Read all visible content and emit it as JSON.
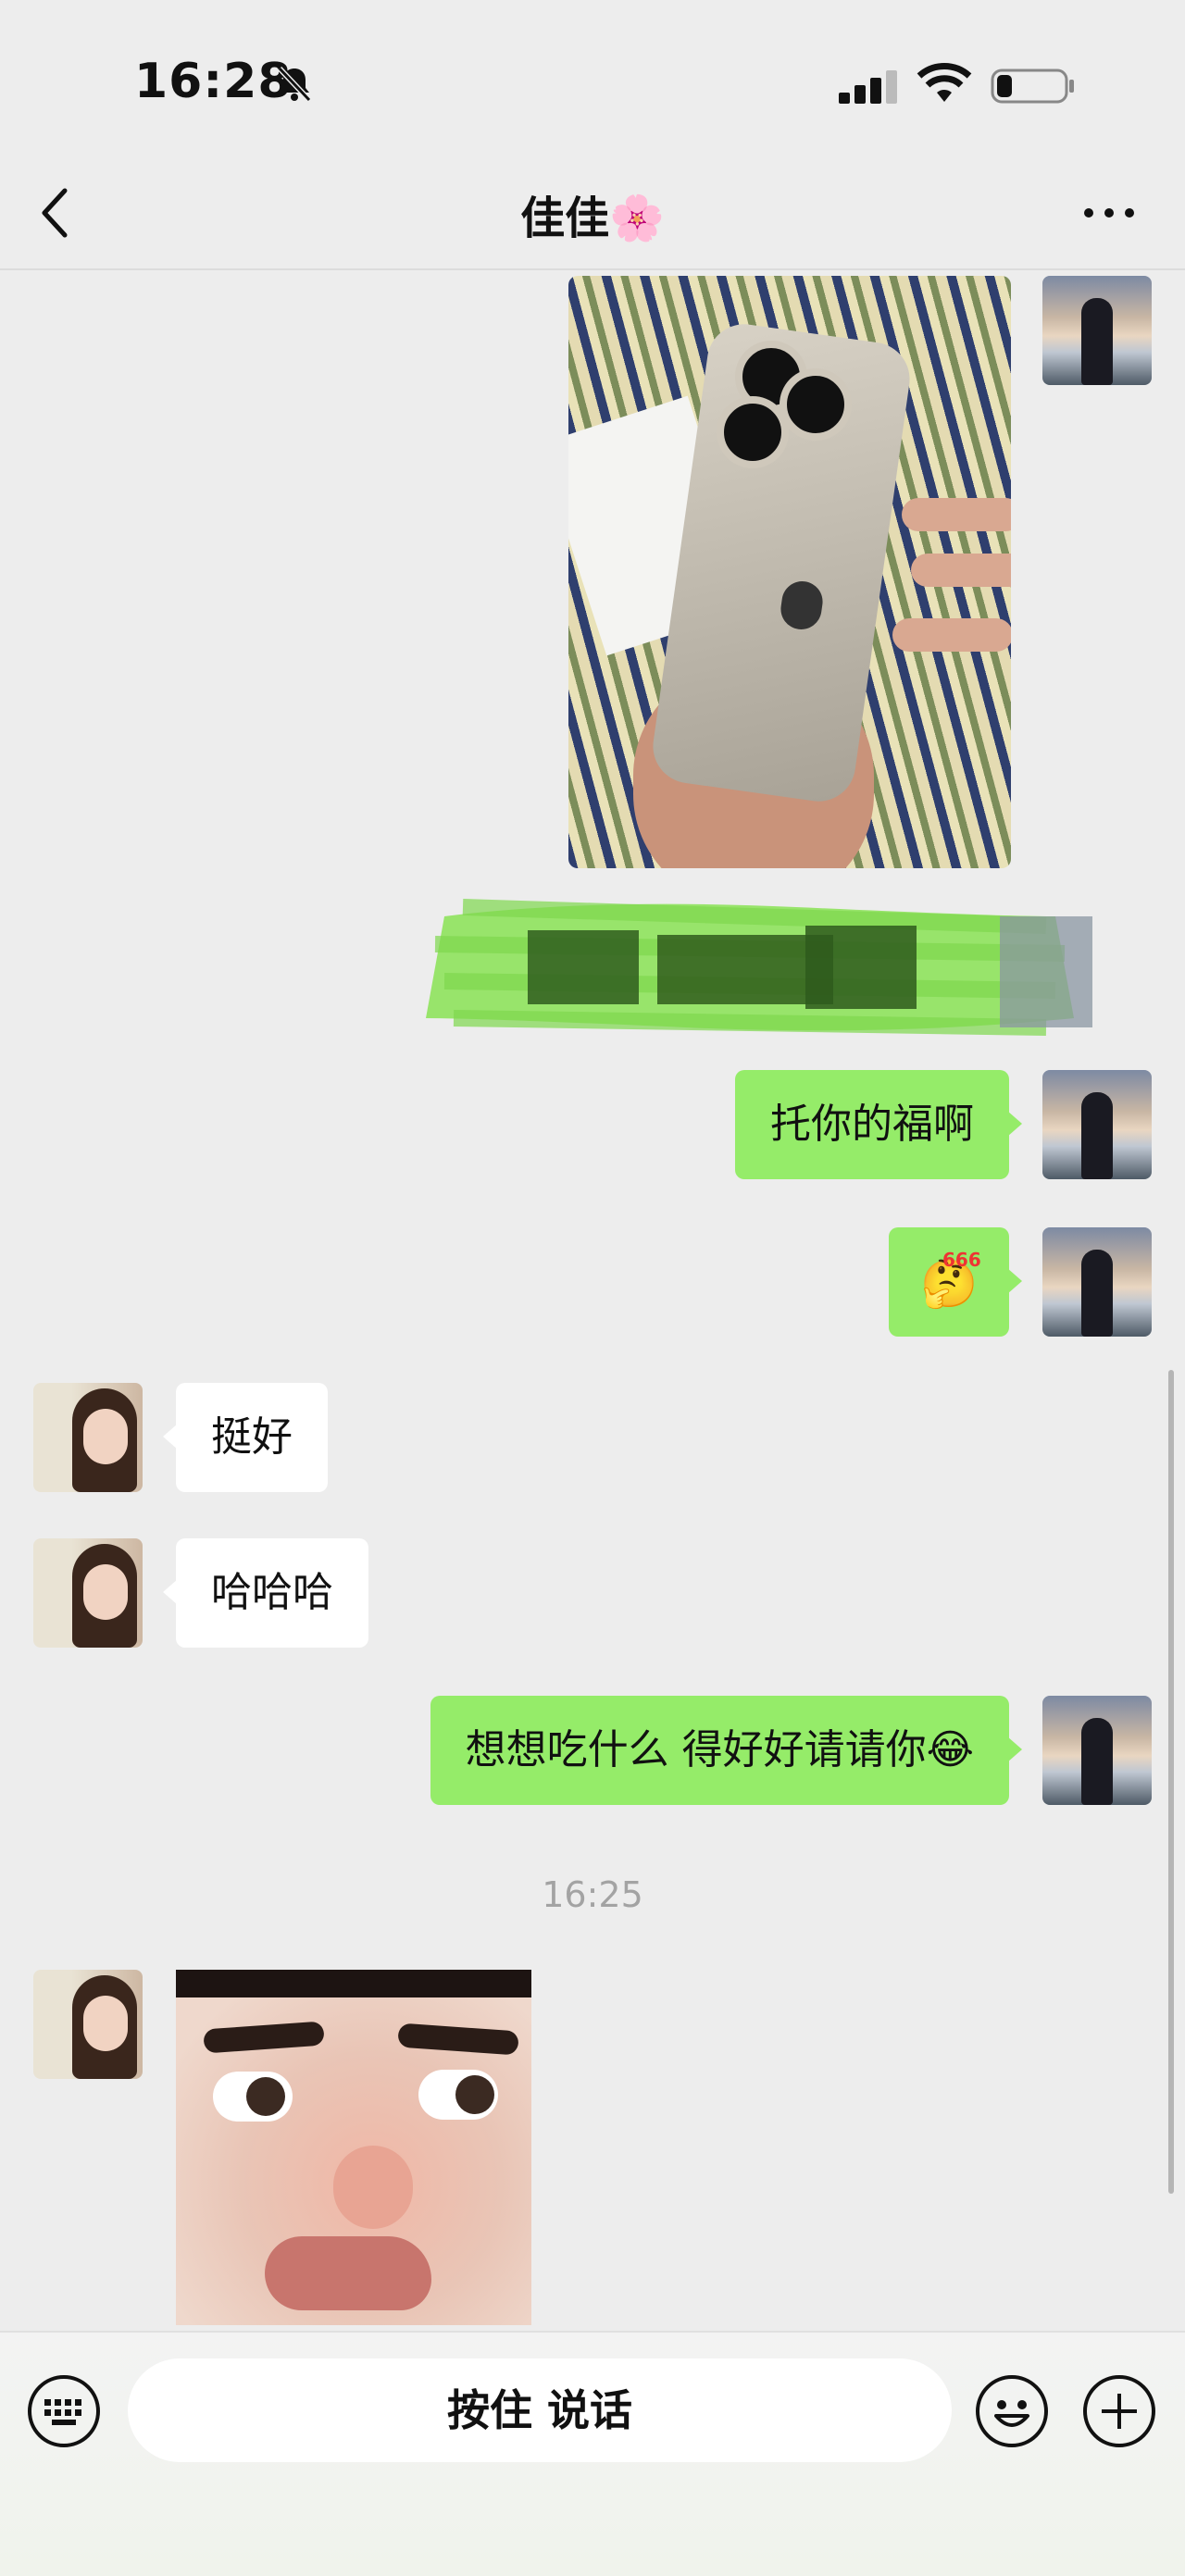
{
  "status_bar": {
    "time": "16:28"
  },
  "header": {
    "title": "佳佳🌸"
  },
  "messages": [
    {
      "text": "托你的福啊"
    },
    {
      "text": "挺好"
    },
    {
      "text": "哈哈哈"
    },
    {
      "text": "想想吃什么  得好好请请你😂"
    }
  ],
  "sticker_666": {
    "label": "666",
    "emoji": "🤔"
  },
  "timestamp": "16:25",
  "input_bar": {
    "hold_to_talk": "按住 说话"
  },
  "colors": {
    "my_bubble": "#95ec69",
    "her_bubble": "#ffffff",
    "background": "#ededed"
  },
  "icons": [
    "muted-bell-icon",
    "signal-icon",
    "wifi-icon",
    "battery-icon",
    "back-icon",
    "more-icon",
    "keyboard-icon",
    "emoji-icon",
    "plus-icon"
  ]
}
